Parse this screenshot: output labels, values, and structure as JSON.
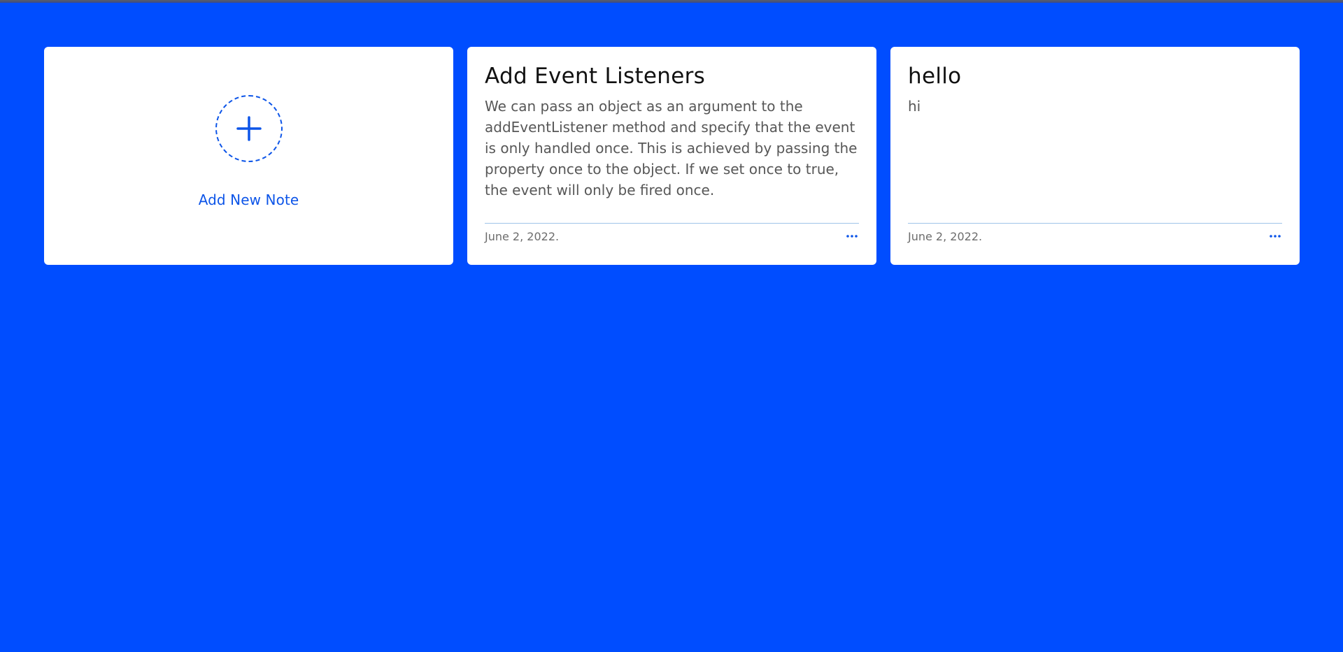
{
  "colors": {
    "background": "#004dff",
    "accent": "#0d55e8",
    "card": "#ffffff",
    "divider": "#9fc4e8"
  },
  "add_note": {
    "icon": "plus-icon",
    "label": "Add New Note"
  },
  "notes": [
    {
      "title": "Add Event Listeners",
      "body": "We can pass an object as an argument to the addEventListener method and specify that the event is only handled once. This is achieved by passing the property once to the object. If we set once to true, the event will only be fired once.",
      "date": "June 2, 2022.",
      "menu_icon": "more-horizontal-icon"
    },
    {
      "title": "hello",
      "body": "hi",
      "date": "June 2, 2022.",
      "menu_icon": "more-horizontal-icon"
    }
  ]
}
